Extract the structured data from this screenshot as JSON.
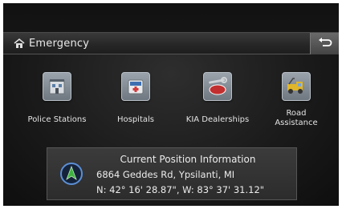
{
  "header": {
    "title": "Emergency",
    "title_icon": "house-icon",
    "back_icon": "return-arrow-icon"
  },
  "categories": [
    {
      "label": "Police Stations",
      "icon": "police-station-icon"
    },
    {
      "label": "Hospitals",
      "icon": "ambulance-icon"
    },
    {
      "label": "KIA Dealerships",
      "icon": "kia-wrench-icon"
    },
    {
      "label": "Road\nAssistance",
      "icon": "tow-truck-icon"
    }
  ],
  "position": {
    "title": "Current Position Information",
    "address": "6864 Geddes Rd, Ypsilanti, MI",
    "coordinates": "N: 42° 16' 28.87\", W: 83° 37' 31.12\"",
    "icon": "navigation-arrow-icon"
  },
  "colors": {
    "accent_green": "#3fb33f",
    "nav_ring": "#5b8fd6"
  }
}
